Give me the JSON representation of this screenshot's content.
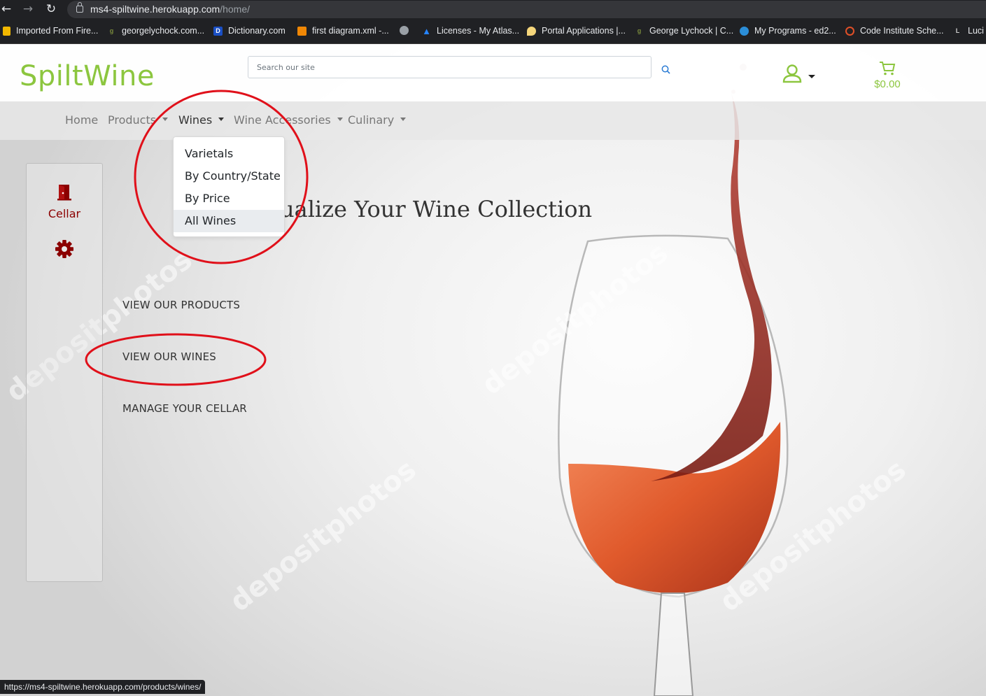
{
  "browser": {
    "url_host": "ms4-spiltwine.herokuapp.com",
    "url_path": "/home/",
    "status_url": "https://ms4-spiltwine.herokuapp.com/products/wines/",
    "bookmarks": [
      {
        "label": "Imported From Fire...",
        "icon": "folder-icon",
        "color": "#f2b800"
      },
      {
        "label": "georgelychock.com...",
        "icon": "site-icon",
        "color": "#7a8b3c"
      },
      {
        "label": "Dictionary.com",
        "icon": "dictionary-icon",
        "color": "#1a4fc4"
      },
      {
        "label": "first diagram.xml -...",
        "icon": "diagram-icon",
        "color": "#f08705"
      },
      {
        "label": "",
        "icon": "globe-icon",
        "color": "#9aa0a6"
      },
      {
        "label": "Licenses - My Atlas...",
        "icon": "atlassian-icon",
        "color": "#2684ff"
      },
      {
        "label": "Portal Applications |...",
        "icon": "portal-icon",
        "color": "#f5d67b"
      },
      {
        "label": "George Lychock | C...",
        "icon": "site-icon",
        "color": "#7a8b3c"
      },
      {
        "label": "My Programs - ed2...",
        "icon": "edx-icon",
        "color": "#2b8ed8"
      },
      {
        "label": "Code Institute Sche...",
        "icon": "ci-icon",
        "color": "#e05028"
      },
      {
        "label": "Luci",
        "icon": "lucid-icon",
        "color": "#cccccc"
      }
    ]
  },
  "site": {
    "logo": "SpiltWine",
    "search_placeholder": "Search our site",
    "cart_total": "$0.00",
    "brand_color": "#8cc63f"
  },
  "nav": [
    {
      "label": "Home",
      "dropdown": false
    },
    {
      "label": "Products",
      "dropdown": true
    },
    {
      "label": "Wines",
      "dropdown": true
    },
    {
      "label": "Wine Accessories",
      "dropdown": true
    },
    {
      "label": "Culinary",
      "dropdown": true
    }
  ],
  "wines_menu": [
    "Varietals",
    "By Country/State",
    "By Price",
    "All Wines"
  ],
  "sidebar": {
    "cellar_label": "Cellar",
    "accent_color": "#8b0000"
  },
  "hero": {
    "title_visible": "ualize Your Wine Collection"
  },
  "links": [
    "VIEW OUR PRODUCTS",
    "VIEW OUR WINES",
    "MANAGE YOUR CELLAR"
  ],
  "watermark": "depositphotos"
}
